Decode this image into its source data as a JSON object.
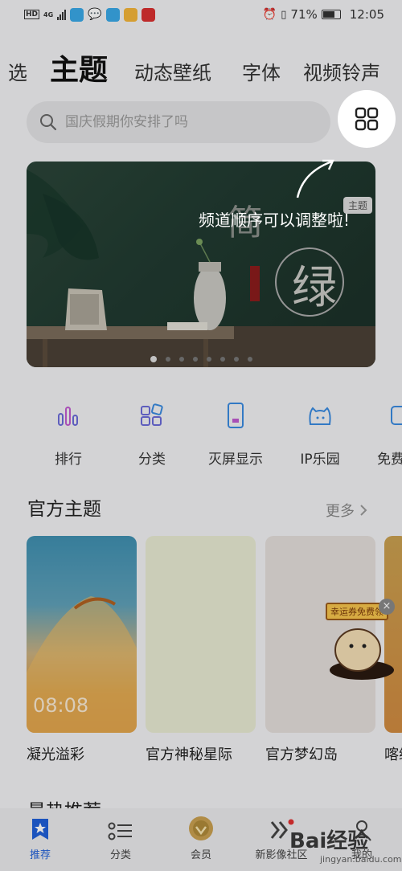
{
  "status": {
    "network": "HD",
    "network_type": "4G",
    "battery": "71%",
    "time": "12:05"
  },
  "tabs": [
    {
      "label": "选"
    },
    {
      "label": "主题",
      "active": true
    },
    {
      "label": "动态壁纸"
    },
    {
      "label": "字体"
    },
    {
      "label": "视频铃声"
    }
  ],
  "search": {
    "placeholder": "国庆假期你安排了吗"
  },
  "banner": {
    "tag": "主题",
    "title_char1": "简",
    "title_char2": "绿"
  },
  "overlay_hint": "频道顺序可以调整啦!",
  "quick_nav": [
    {
      "label": "排行",
      "icon": "ranking-icon"
    },
    {
      "label": "分类",
      "icon": "category-icon"
    },
    {
      "label": "灭屏显示",
      "icon": "aod-icon"
    },
    {
      "label": "IP乐园",
      "icon": "ip-park-icon"
    },
    {
      "label": "免费",
      "icon": "free-icon"
    }
  ],
  "official_section": {
    "title": "官方主题",
    "more": "更多",
    "cards": [
      {
        "label": "凝光溢彩",
        "time": "08:08"
      },
      {
        "label": "官方神秘星际"
      },
      {
        "label": "官方梦幻岛"
      },
      {
        "label": "喀纳"
      }
    ]
  },
  "promo": {
    "tag": "幸运券免费领"
  },
  "next_section": {
    "title": "最热推荐"
  },
  "bottom_nav": [
    {
      "label": "推荐",
      "active": true
    },
    {
      "label": "分类"
    },
    {
      "label": "会员"
    },
    {
      "label": "新影像社区"
    },
    {
      "label": "我的"
    }
  ],
  "watermark": {
    "text": "Bai经验",
    "sub": "jingyan.baidu.com"
  },
  "colors": {
    "accent": "#1f5fd8",
    "icon_purple": "#6a6ad8",
    "icon_blue": "#3a8ae0"
  }
}
